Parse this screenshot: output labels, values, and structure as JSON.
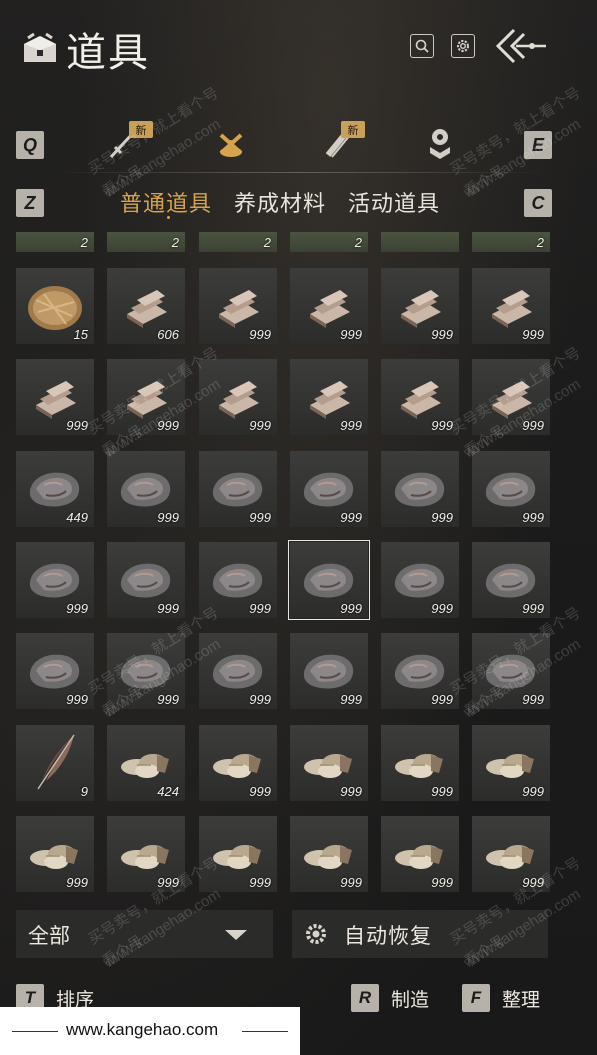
{
  "header": {
    "title": "道具"
  },
  "category_keys": {
    "left": "Q",
    "right": "E",
    "sub_left": "Z",
    "sub_right": "C"
  },
  "categories": [
    {
      "name": "sword-icon",
      "new_badge": "新"
    },
    {
      "name": "bag-icon",
      "active": true
    },
    {
      "name": "scroll-icon",
      "new_badge": "新"
    },
    {
      "name": "badge-icon"
    }
  ],
  "subtabs": [
    "普通道具",
    "养成材料",
    "活动道具"
  ],
  "active_subtab": 0,
  "inventory": {
    "partial_row_counts": [
      "2",
      "2",
      "2",
      "2",
      "",
      "2"
    ],
    "rows": [
      [
        {
          "item": "fiber-icon",
          "count": "15"
        },
        {
          "item": "wood-icon",
          "count": "606"
        },
        {
          "item": "wood-icon",
          "count": "999"
        },
        {
          "item": "wood-icon",
          "count": "999"
        },
        {
          "item": "wood-icon",
          "count": "999"
        },
        {
          "item": "wood-icon",
          "count": "999"
        }
      ],
      [
        {
          "item": "wood-icon",
          "count": "999"
        },
        {
          "item": "wood-icon",
          "count": "999"
        },
        {
          "item": "wood-icon",
          "count": "999"
        },
        {
          "item": "wood-icon",
          "count": "999"
        },
        {
          "item": "wood-icon",
          "count": "999"
        },
        {
          "item": "wood-icon",
          "count": "999"
        }
      ],
      [
        {
          "item": "ore-icon",
          "count": "449"
        },
        {
          "item": "ore-icon",
          "count": "999"
        },
        {
          "item": "ore-icon",
          "count": "999"
        },
        {
          "item": "ore-icon",
          "count": "999"
        },
        {
          "item": "ore-icon",
          "count": "999"
        },
        {
          "item": "ore-icon",
          "count": "999"
        }
      ],
      [
        {
          "item": "ore-icon",
          "count": "999"
        },
        {
          "item": "ore-icon",
          "count": "999"
        },
        {
          "item": "ore-icon",
          "count": "999"
        },
        {
          "item": "ore-icon",
          "count": "999",
          "selected": true
        },
        {
          "item": "ore-icon",
          "count": "999"
        },
        {
          "item": "ore-icon",
          "count": "999"
        }
      ],
      [
        {
          "item": "ore-icon",
          "count": "999"
        },
        {
          "item": "ore-icon",
          "count": "999"
        },
        {
          "item": "ore-icon",
          "count": "999"
        },
        {
          "item": "ore-icon",
          "count": "999"
        },
        {
          "item": "ore-icon",
          "count": "999"
        },
        {
          "item": "ore-icon",
          "count": "999"
        }
      ],
      [
        {
          "item": "feather-icon",
          "count": "9"
        },
        {
          "item": "shell-icon",
          "count": "424"
        },
        {
          "item": "shell-icon",
          "count": "999"
        },
        {
          "item": "shell-icon",
          "count": "999"
        },
        {
          "item": "shell-icon",
          "count": "999"
        },
        {
          "item": "shell-icon",
          "count": "999"
        }
      ],
      [
        {
          "item": "shell-icon",
          "count": "999"
        },
        {
          "item": "shell-icon",
          "count": "999"
        },
        {
          "item": "shell-icon",
          "count": "999"
        },
        {
          "item": "shell-icon",
          "count": "999"
        },
        {
          "item": "shell-icon",
          "count": "999"
        },
        {
          "item": "shell-icon",
          "count": "999"
        }
      ]
    ]
  },
  "filter": {
    "label": "全部"
  },
  "auto_restore": {
    "label": "自动恢复"
  },
  "actions": [
    {
      "key": "T",
      "label": "排序"
    },
    {
      "key": "R",
      "label": "制造"
    },
    {
      "key": "F",
      "label": "整理"
    }
  ],
  "watermark": {
    "line1": "买号卖号，就上看个号",
    "line2": "www.kangehao.com",
    "line3": "看个号"
  },
  "site": {
    "url": "www.kangehao.com"
  },
  "colors": {
    "accent": "#d6a44a",
    "badge": "#c9a05a",
    "slot": "#353534"
  }
}
